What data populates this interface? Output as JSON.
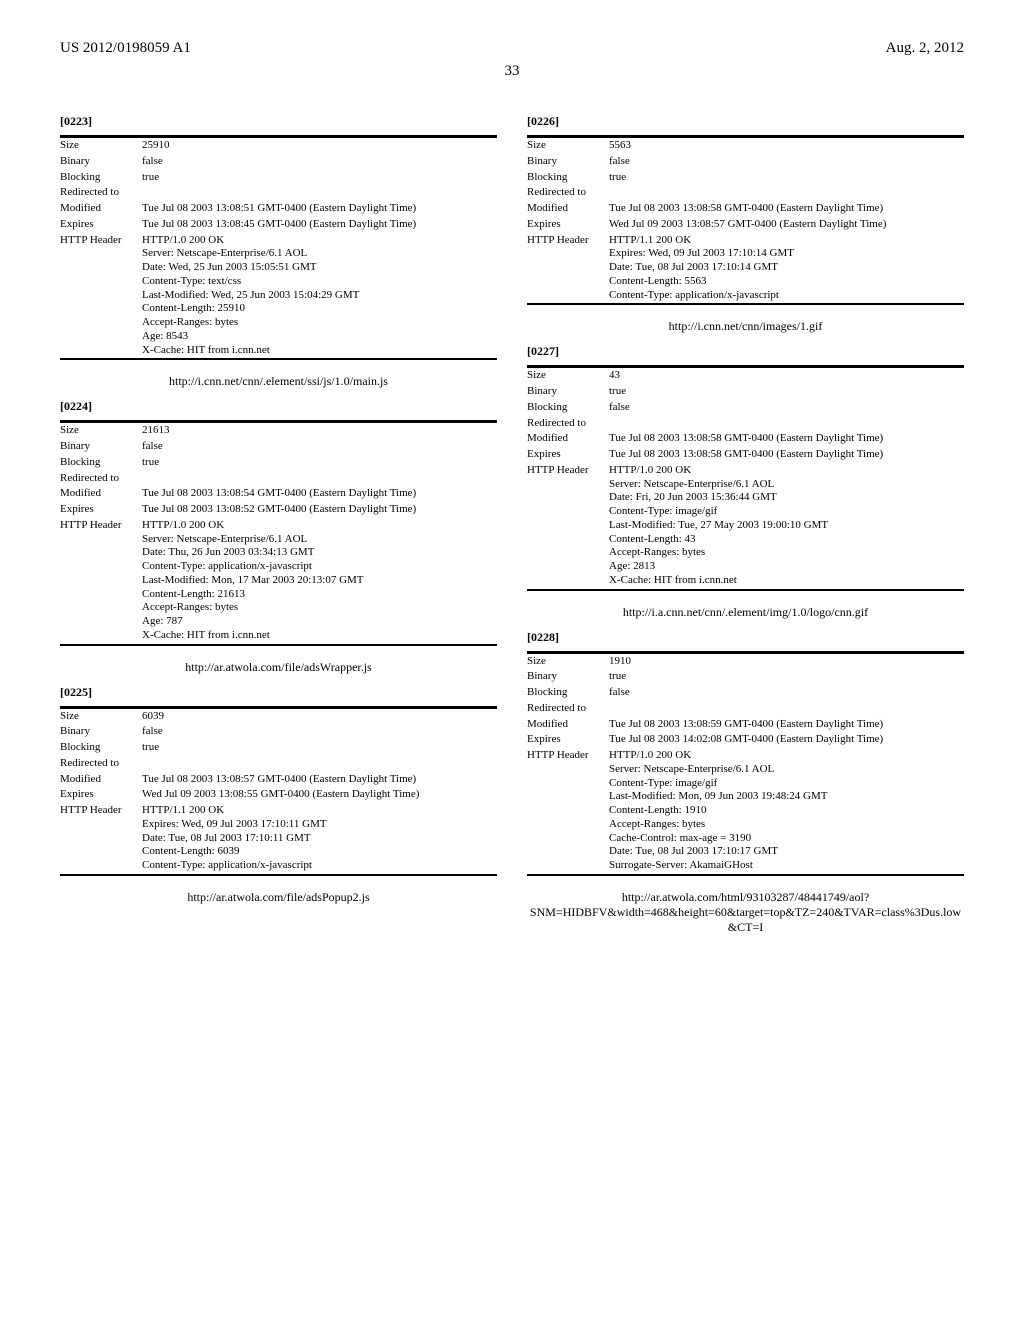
{
  "header": {
    "pub_no": "US 2012/0198059 A1",
    "date": "Aug. 2, 2012",
    "page": "33"
  },
  "left": {
    "blocks": [
      {
        "num": "[0223]",
        "rows": [
          [
            "Size",
            "25910"
          ],
          [
            "Binary",
            "false"
          ],
          [
            "Blocking",
            "true"
          ],
          [
            "Redirected to",
            ""
          ],
          [
            "Modified",
            "Tue Jul 08 2003 13:08:51 GMT-0400 (Eastern Daylight Time)"
          ],
          [
            "Expires",
            "Tue Jul 08 2003 13:08:45 GMT-0400 (Eastern Daylight Time)"
          ],
          [
            "HTTP Header",
            "HTTP/1.0 200 OK\nServer: Netscape-Enterprise/6.1 AOL\nDate: Wed, 25 Jun 2003 15:05:51 GMT\nContent-Type: text/css\nLast-Modified: Wed, 25 Jun 2003 15:04:29 GMT\nContent-Length: 25910\nAccept-Ranges: bytes\nAge: 8543\nX-Cache: HIT from i.cnn.net"
          ]
        ],
        "url": "http://i.cnn.net/cnn/.element/ssi/js/1.0/main.js"
      },
      {
        "num": "[0224]",
        "rows": [
          [
            "Size",
            "21613"
          ],
          [
            "Binary",
            "false"
          ],
          [
            "Blocking",
            "true"
          ],
          [
            "Redirected to",
            ""
          ],
          [
            "Modified",
            "Tue Jul 08 2003 13:08:54 GMT-0400 (Eastern Daylight Time)"
          ],
          [
            "Expires",
            "Tue Jul 08 2003 13:08:52 GMT-0400 (Eastern Daylight Time)"
          ],
          [
            "HTTP Header",
            "HTTP/1.0 200 OK\nServer: Netscape-Enterprise/6.1 AOL\nDate: Thu, 26 Jun 2003 03:34:13 GMT\nContent-Type: application/x-javascript\nLast-Modified: Mon, 17 Mar 2003 20:13:07 GMT\nContent-Length: 21613\nAccept-Ranges: bytes\nAge: 787\nX-Cache: HIT from i.cnn.net"
          ]
        ],
        "url": "http://ar.atwola.com/file/adsWrapper.js"
      },
      {
        "num": "[0225]",
        "rows": [
          [
            "Size",
            "6039"
          ],
          [
            "Binary",
            "false"
          ],
          [
            "Blocking",
            "true"
          ],
          [
            "Redirected to",
            ""
          ],
          [
            "Modified",
            "Tue Jul 08 2003 13:08:57 GMT-0400 (Eastern Daylight Time)"
          ],
          [
            "Expires",
            "Wed Jul 09 2003 13:08:55 GMT-0400 (Eastern Daylight Time)"
          ],
          [
            "HTTP Header",
            "HTTP/1.1 200 OK\nExpires: Wed, 09 Jul 2003 17:10:11 GMT\nDate: Tue, 08 Jul 2003 17:10:11 GMT\nContent-Length: 6039\nContent-Type: application/x-javascript"
          ]
        ],
        "url": "http://ar.atwola.com/file/adsPopup2.js"
      }
    ]
  },
  "right": {
    "blocks": [
      {
        "num": "[0226]",
        "rows": [
          [
            "Size",
            "5563"
          ],
          [
            "Binary",
            "false"
          ],
          [
            "Blocking",
            "true"
          ],
          [
            "Redirected to",
            ""
          ],
          [
            "Modified",
            "Tue Jul 08 2003 13:08:58 GMT-0400 (Eastern Daylight Time)"
          ],
          [
            "Expires",
            "Wed Jul 09 2003 13:08:57 GMT-0400 (Eastern Daylight Time)"
          ],
          [
            "HTTP Header",
            "HTTP/1.1 200 OK\nExpires: Wed, 09 Jul 2003 17:10:14 GMT\nDate: Tue, 08 Jul 2003 17:10:14 GMT\nContent-Length: 5563\nContent-Type: application/x-javascript"
          ]
        ],
        "url": "http://i.cnn.net/cnn/images/1.gif"
      },
      {
        "num": "[0227]",
        "rows": [
          [
            "Size",
            "43"
          ],
          [
            "Binary",
            "true"
          ],
          [
            "Blocking",
            "false"
          ],
          [
            "Redirected to",
            ""
          ],
          [
            "Modified",
            "Tue Jul 08 2003 13:08:58 GMT-0400 (Eastern Daylight Time)"
          ],
          [
            "Expires",
            "Tue Jul 08 2003 13:08:58 GMT-0400 (Eastern Daylight Time)"
          ],
          [
            "HTTP Header",
            "HTTP/1.0 200 OK\nServer: Netscape-Enterprise/6.1 AOL\nDate: Fri, 20 Jun 2003 15:36:44 GMT\nContent-Type: image/gif\nLast-Modified: Tue, 27 May 2003 19:00:10 GMT\nContent-Length: 43\nAccept-Ranges: bytes\nAge: 2813\nX-Cache: HIT from i.cnn.net"
          ]
        ],
        "url": "http://i.a.cnn.net/cnn/.element/img/1.0/logo/cnn.gif"
      },
      {
        "num": "[0228]",
        "rows": [
          [
            "Size",
            "1910"
          ],
          [
            "Binary",
            "true"
          ],
          [
            "Blocking",
            "false"
          ],
          [
            "Redirected to",
            ""
          ],
          [
            "Modified",
            "Tue Jul 08 2003 13:08:59 GMT-0400 (Eastern Daylight Time)"
          ],
          [
            "Expires",
            "Tue Jul 08 2003 14:02:08 GMT-0400 (Eastern Daylight Time)"
          ],
          [
            "HTTP Header",
            "HTTP/1.0 200 OK\nServer: Netscape-Enterprise/6.1 AOL\nContent-Type: image/gif\nLast-Modified: Mon, 09 Jun 2003 19:48:24 GMT\nContent-Length: 1910\nAccept-Ranges: bytes\nCache-Control: max-age = 3190\nDate: Tue, 08 Jul 2003 17:10:17 GMT\nSurrogate-Server: AkamaiGHost"
          ]
        ],
        "url": "http://ar.atwola.com/html/93103287/48441749/aol?SNM=HIDBFV&width=468&height=60&target=top&TZ=240&TVAR=class%3Dus.low&CT=I"
      }
    ]
  }
}
